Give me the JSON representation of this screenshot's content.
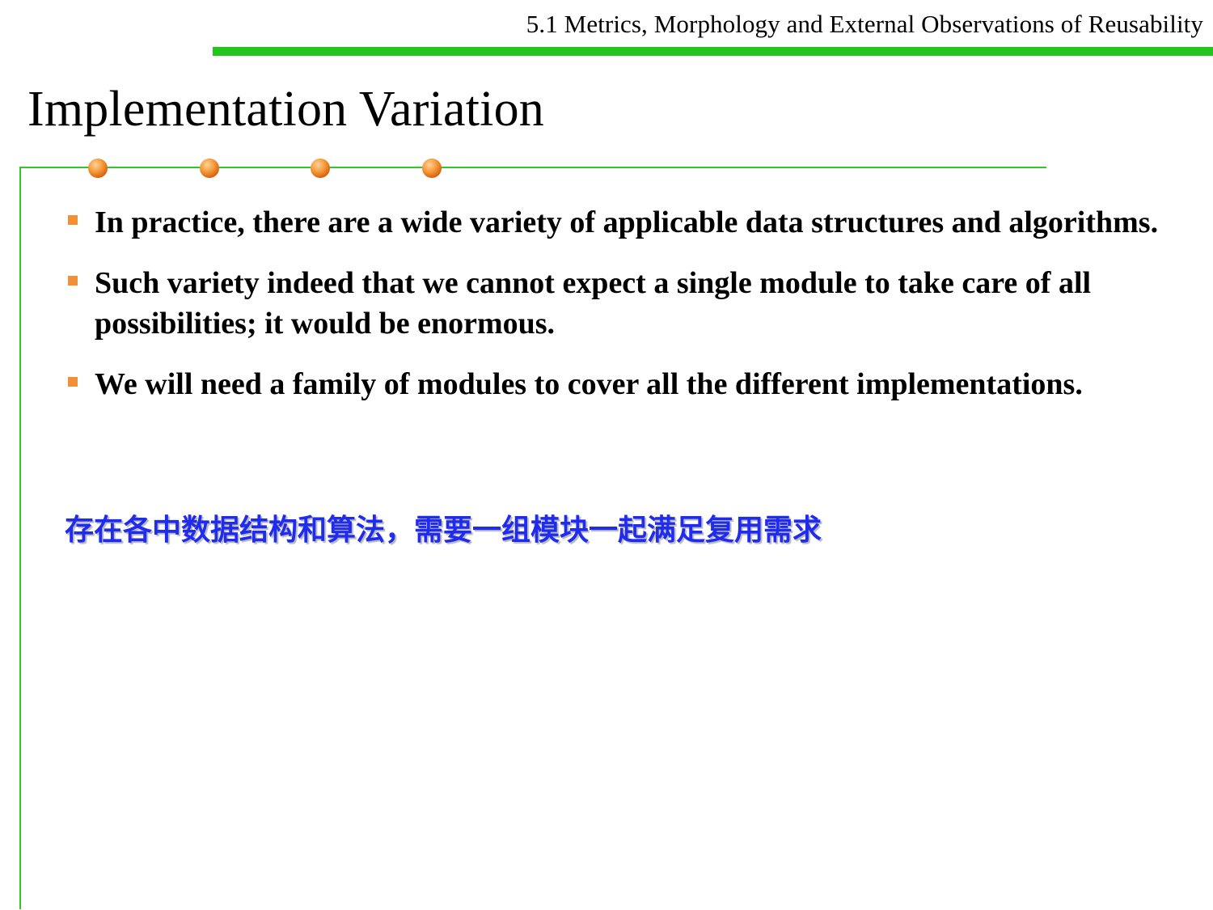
{
  "header": {
    "section_title": "5.1 Metrics, Morphology and External Observations of Reusability"
  },
  "slide": {
    "title": "Implementation Variation",
    "bullets": [
      "In practice, there are  a wide variety of applicable data structures and algorithms.",
      "Such variety indeed that we cannot expect a single module to take care of all possibilities; it would be enormous.",
      "We will need a family of modules to cover all the different implementations."
    ],
    "note": "存在各中数据结构和算法，需要一组模块一起满足复用需求"
  },
  "colors": {
    "accent_green": "#22c51c",
    "frame_green": "#34c42c",
    "dot_orange": "#f08a2e",
    "bullet_orange": "#f2903a",
    "note_blue": "#1f2cf0"
  },
  "icons": {
    "decor_dots": "orange-circle-icon",
    "bullet_marker": "orange-square-bullet-icon"
  }
}
